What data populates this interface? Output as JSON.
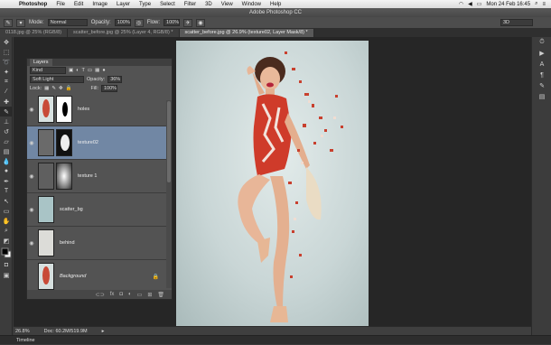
{
  "menubar": {
    "app": "Photoshop",
    "items": [
      "File",
      "Edit",
      "Image",
      "Layer",
      "Type",
      "Select",
      "Filter",
      "3D",
      "View",
      "Window",
      "Help"
    ],
    "clock": "Mon 24 Feb  16:45"
  },
  "window": {
    "title": "Adobe Photoshop CC"
  },
  "options": {
    "mode_label": "Mode:",
    "mode_value": "Normal",
    "opacity_label": "Opacity:",
    "opacity_value": "100%",
    "flow_label": "Flow:",
    "flow_value": "100%",
    "workspace": "3D"
  },
  "tabs": [
    {
      "label": "0118.jpg @ 25% (RGB/8)",
      "active": false
    },
    {
      "label": "scatter_before.jpg @ 25% (Layer 4, RGB/8) *",
      "active": false
    },
    {
      "label": "scatter_before.jpg @ 26.9% (texture02, Layer Mask/8) *",
      "active": true
    }
  ],
  "layers_panel": {
    "title": "Layers",
    "filter": "Kind",
    "blend_mode": "Soft Light",
    "opacity_label": "Opacity:",
    "opacity_value": "36%",
    "lock_label": "Lock:",
    "fill_label": "Fill:",
    "fill_value": "100%",
    "layers": [
      {
        "name": "holes",
        "selected": false,
        "italic": false
      },
      {
        "name": "texture02",
        "selected": true,
        "italic": false
      },
      {
        "name": "texture 1",
        "selected": false,
        "italic": false
      },
      {
        "name": "scatter_bg",
        "selected": false,
        "italic": false
      },
      {
        "name": "behind",
        "selected": false,
        "italic": false
      },
      {
        "name": "Background",
        "selected": false,
        "italic": true
      }
    ]
  },
  "status": {
    "zoom": "26.8%",
    "doc": "Doc: 60.2M/519.9M"
  },
  "timeline": {
    "label": "Timeline"
  },
  "colors": {
    "selected_layer": "#7187a4",
    "panel": "#535353",
    "canvas_bg": "#262626"
  }
}
